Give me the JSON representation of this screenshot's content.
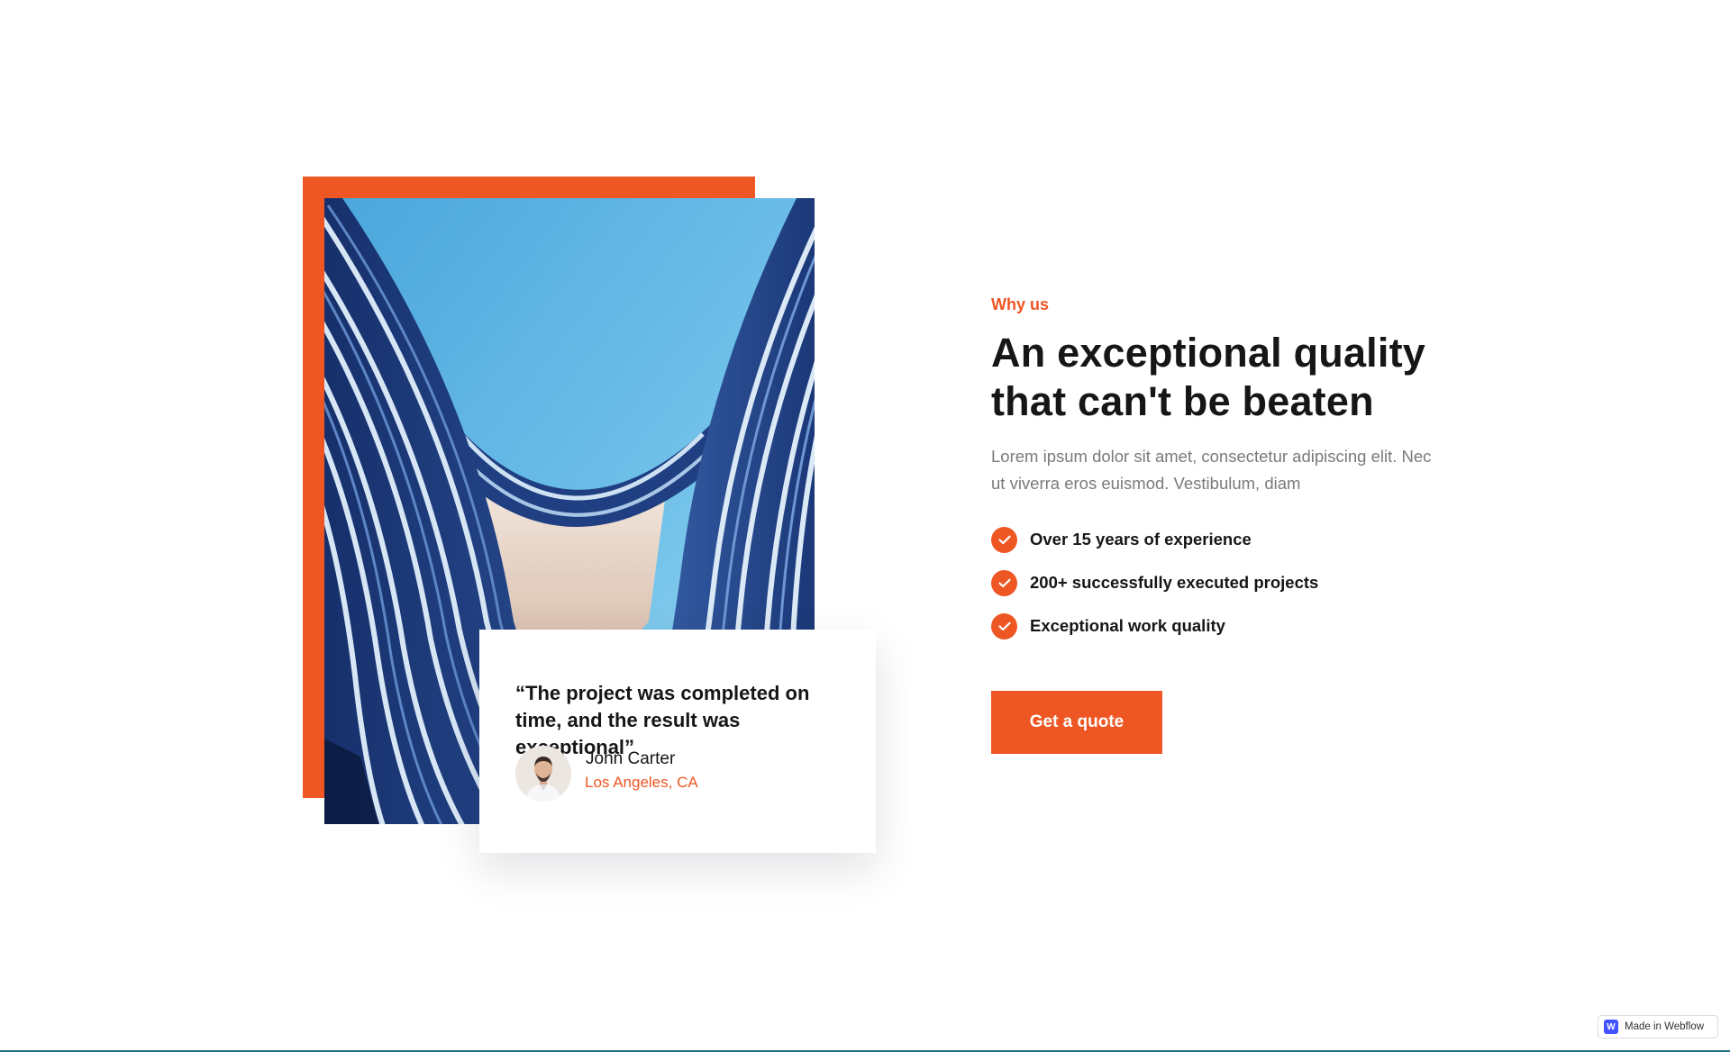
{
  "colors": {
    "accent": "#ee5623",
    "heading": "#161616",
    "body_text": "#7a7a7a",
    "webflow_blue": "#4353ff"
  },
  "hero_image": {
    "icon": "architecture-photo"
  },
  "testimonial": {
    "quote": "“The project was completed on time, and the result was exceptional”",
    "author_name": "John Carter",
    "author_location": "Los Angeles, CA",
    "avatar_icon": "avatar"
  },
  "section": {
    "eyebrow": "Why us",
    "headline": "An exceptional quality that can't be beaten",
    "description": "Lorem ipsum dolor sit amet, consectetur adipiscing elit. Nec ut viverra eros euismod. Vestibulum, diam",
    "features": [
      {
        "label": "Over 15 years of experience",
        "icon": "check-icon"
      },
      {
        "label": "200+ successfully executed projects",
        "icon": "check-icon"
      },
      {
        "label": "Exceptional work quality",
        "icon": "check-icon"
      }
    ],
    "cta_label": "Get a quote"
  },
  "badge": {
    "label": "Made in Webflow",
    "icon_glyph": "W"
  }
}
